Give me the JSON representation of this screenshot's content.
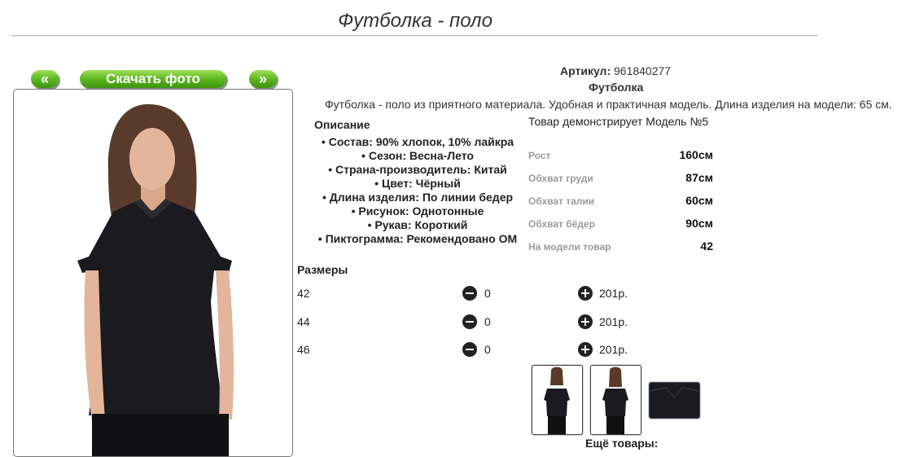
{
  "page": {
    "title": "Футболка - поло"
  },
  "nav": {
    "prev_label": "«",
    "download_label": "Скачать фото",
    "next_label": "»"
  },
  "product": {
    "article_label": "Артикул:",
    "article_value": "961840277",
    "name": "Футболка",
    "description": "Футболка - поло из приятного материала. Удобная и практичная модель. Длина изделия на модели: 65 см."
  },
  "description_block": {
    "title": "Описание",
    "items": [
      "Состав: 90% хлопок, 10% лайкра",
      "Сезон: Весна-Лето",
      "Страна-производитель: Китай",
      "Цвет: Чёрный",
      "Длина изделия: По линии бедер",
      "Рисунок: Однотонные",
      "Рукав: Короткий",
      "Пиктограмма: Рекомендовано ОМ"
    ]
  },
  "model": {
    "note": "Товар демонстрирует Модель №5",
    "measurements": [
      {
        "label": "Рост",
        "value": "160см"
      },
      {
        "label": "Обхват груди",
        "value": "87см"
      },
      {
        "label": "Обхват талии",
        "value": "60см"
      },
      {
        "label": "Обхват бёдер",
        "value": "90см"
      },
      {
        "label": "На модели товар",
        "value": "42"
      }
    ]
  },
  "sizes": {
    "title": "Размеры",
    "rows": [
      {
        "size": "42",
        "qty": "0",
        "price": "201р."
      },
      {
        "size": "44",
        "qty": "0",
        "price": "201р."
      },
      {
        "size": "46",
        "qty": "0",
        "price": "201р."
      }
    ]
  },
  "more": {
    "label": "Ещё товары:"
  },
  "colors": {
    "button_green": "#5cb81f",
    "garment": "#1b1b1f",
    "label_gray": "#9a9a9a"
  },
  "icons": {
    "minus": "minus-circle-icon",
    "plus": "plus-circle-icon"
  }
}
